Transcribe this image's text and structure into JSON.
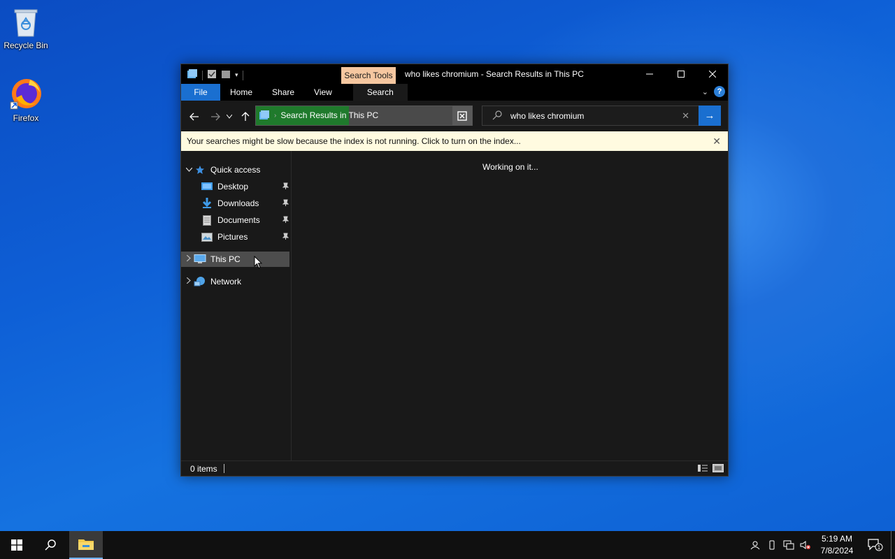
{
  "desktop": {
    "icons": [
      {
        "label": "Recycle Bin",
        "icon": "recycle-bin-icon"
      },
      {
        "label": "Firefox",
        "icon": "firefox-icon"
      }
    ]
  },
  "window": {
    "title": "who likes chromium - Search Results in This PC",
    "context_tab": "Search Tools",
    "ribbon_tabs": [
      "File",
      "Home",
      "Share",
      "View",
      "Search"
    ],
    "help": "?",
    "address": {
      "location": "Search Results in This PC",
      "separator": "›"
    },
    "search": {
      "query": "who likes chromium",
      "clear": "✕",
      "go": "→"
    },
    "infobar": {
      "message": "Your searches might be slow because the index is not running.  Click to turn on the index...",
      "close": "✕"
    },
    "nav_pane": {
      "quick_access": "Quick access",
      "items": [
        {
          "label": "Desktop",
          "icon": "desktop-folder-icon",
          "pinned": true
        },
        {
          "label": "Downloads",
          "icon": "downloads-folder-icon",
          "pinned": true
        },
        {
          "label": "Documents",
          "icon": "documents-folder-icon",
          "pinned": true
        },
        {
          "label": "Pictures",
          "icon": "pictures-folder-icon",
          "pinned": true
        }
      ],
      "this_pc": "This PC",
      "network": "Network"
    },
    "content": {
      "status_message": "Working on it..."
    },
    "statusbar": {
      "item_count": "0 items"
    },
    "address_progress": 0.43
  },
  "taskbar": {
    "time": "5:19 AM",
    "date": "7/8/2024",
    "notification_count": "1"
  },
  "colors": {
    "accent": "#1a6fd0",
    "context_tab": "#f6c7a0",
    "infobar_bg": "#fffbe0",
    "progress_green": "#1f7a2c"
  }
}
